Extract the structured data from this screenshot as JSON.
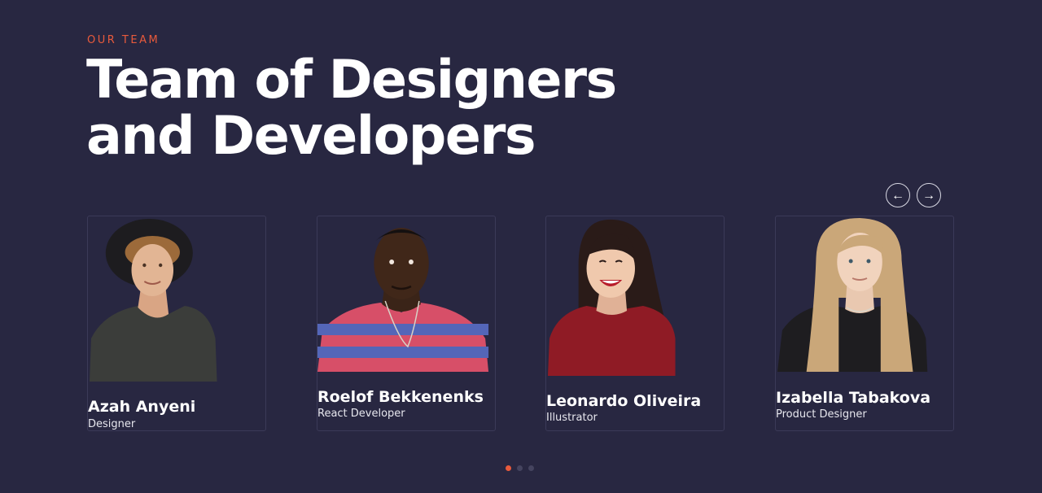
{
  "section": {
    "eyebrow": "OUR TEAM",
    "title_line_1": "Team of Designers",
    "title_line_2": "and Developers"
  },
  "carousel": {
    "prev_label": "←",
    "next_label": "→",
    "prev_icon": "arrow-left-icon",
    "next_icon": "arrow-right-icon",
    "slides_count": 3,
    "active_slide": 1
  },
  "team": [
    {
      "name": "Azah Anyeni",
      "role": "Designer"
    },
    {
      "name": "Roelof Bekkenenks",
      "role": "React Developer"
    },
    {
      "name": "Leonardo Oliveira",
      "role": "Illustrator"
    },
    {
      "name": "Izabella Tabakova",
      "role": "Product Designer"
    }
  ],
  "colors": {
    "background": "#282741",
    "accent": "#e85a3c",
    "card_border": "#3b3a58",
    "text": "#ffffff"
  }
}
